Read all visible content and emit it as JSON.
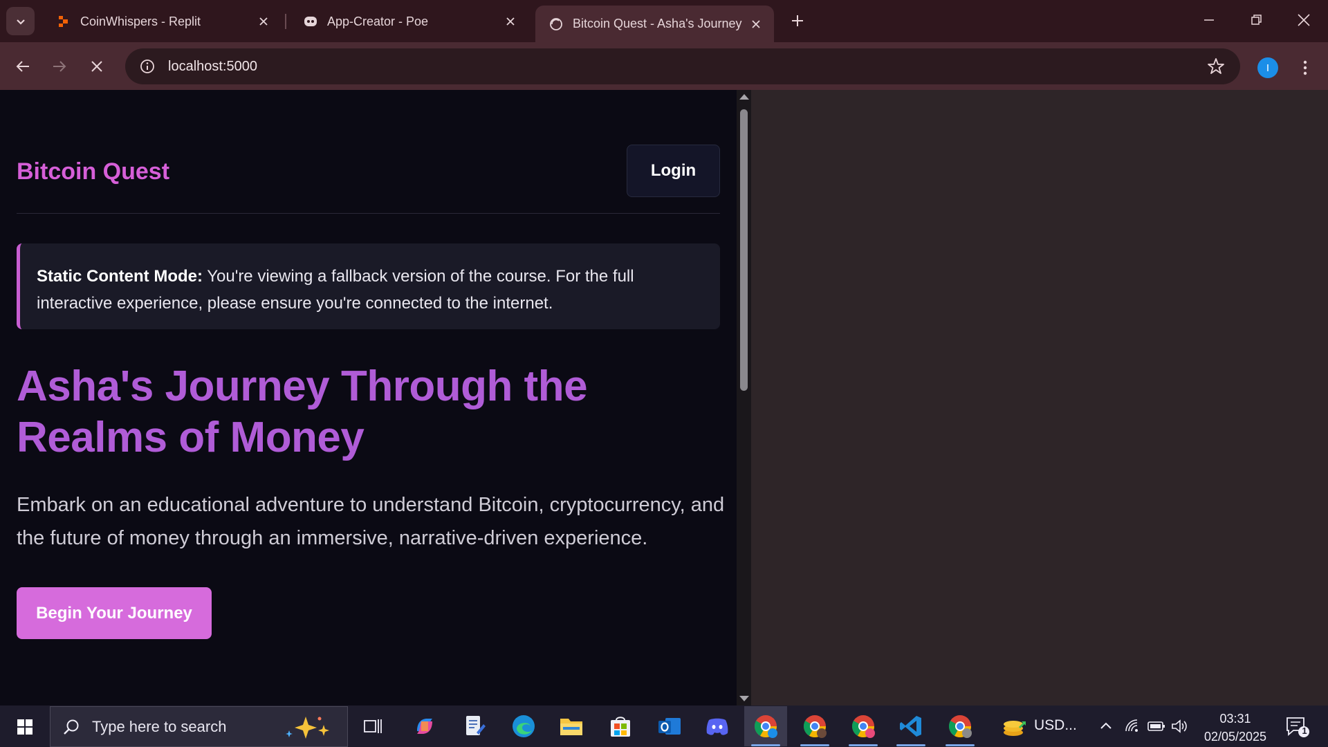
{
  "browser": {
    "tabs": [
      {
        "title": "CoinWhispers - Replit",
        "active": false
      },
      {
        "title": "App-Creator - Poe",
        "active": false
      },
      {
        "title": "Bitcoin Quest - Asha's Journey",
        "active": true
      }
    ],
    "url": "localhost:5000",
    "profile_initial": "I"
  },
  "page": {
    "logo": "Bitcoin Quest",
    "login_label": "Login",
    "notice": {
      "label": "Static Content Mode:",
      "text": " You're viewing a fallback version of the course. For the full interactive experience, please ensure you're connected to the internet."
    },
    "hero_title": "Asha's Journey Through the Realms of Money",
    "hero_description": "Embark on an educational adventure to understand Bitcoin, cryptocurrency, and the future of money through an immersive, narrative-driven experience.",
    "cta_label": "Begin Your Journey"
  },
  "taskbar": {
    "search_placeholder": "Type here to search",
    "usd_label": "USD...",
    "time": "03:31",
    "date": "02/05/2025",
    "notification_count": "1"
  },
  "colors": {
    "accent_pink": "#d66bdc",
    "title_purple": "#b05cd7",
    "page_bg": "#0b0a14"
  }
}
